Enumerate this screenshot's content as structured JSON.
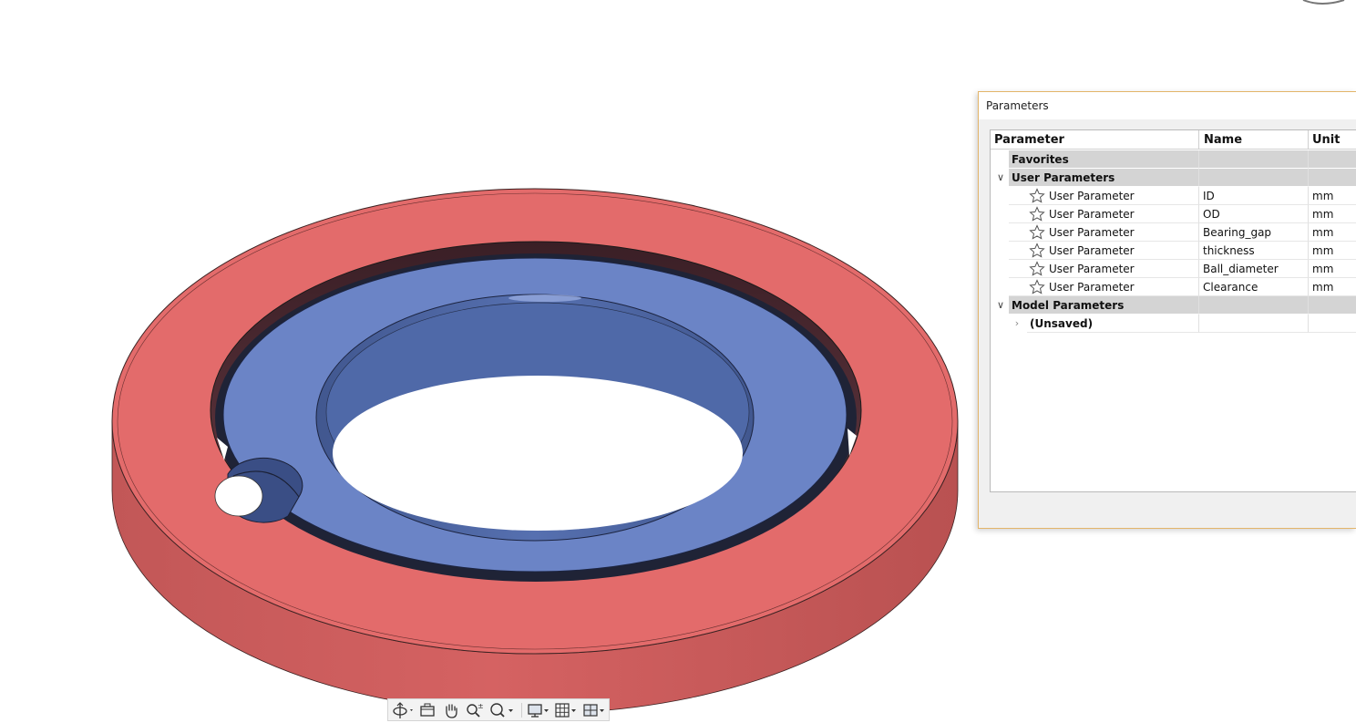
{
  "colors": {
    "outer_ring": "#e36b6b",
    "outer_ring_side": "#c45a5a",
    "inner_ring": "#6b84c6",
    "inner_ring_dark": "#4e66a3",
    "dialog_border": "#e3b56a",
    "group_row": "#d4d4d4"
  },
  "dialog": {
    "title": "Parameters"
  },
  "table": {
    "headers": {
      "parameter": "Parameter",
      "name": "Name",
      "unit": "Unit"
    },
    "favorites": {
      "label": "Favorites"
    },
    "user_parameters": {
      "label": "User Parameters",
      "add_icon": "plus-icon",
      "rows": [
        {
          "parameter": "User Parameter",
          "name": "ID",
          "unit": "mm"
        },
        {
          "parameter": "User Parameter",
          "name": "OD",
          "unit": "mm"
        },
        {
          "parameter": "User Parameter",
          "name": "Bearing_gap",
          "unit": "mm"
        },
        {
          "parameter": "User Parameter",
          "name": "thickness",
          "unit": "mm"
        },
        {
          "parameter": "User Parameter",
          "name": "Ball_diameter",
          "unit": "mm"
        },
        {
          "parameter": "User Parameter",
          "name": "Clearance",
          "unit": "mm"
        }
      ]
    },
    "model_parameters": {
      "label": "Model Parameters",
      "children": [
        {
          "label": "(Unsaved)"
        }
      ]
    }
  },
  "toolbar": {
    "tools": [
      "orbit-icon",
      "look-at-icon",
      "pan-icon",
      "zoom-icon",
      "fit-icon",
      "display-settings-icon",
      "grid-snaps-icon",
      "viewports-icon"
    ]
  }
}
